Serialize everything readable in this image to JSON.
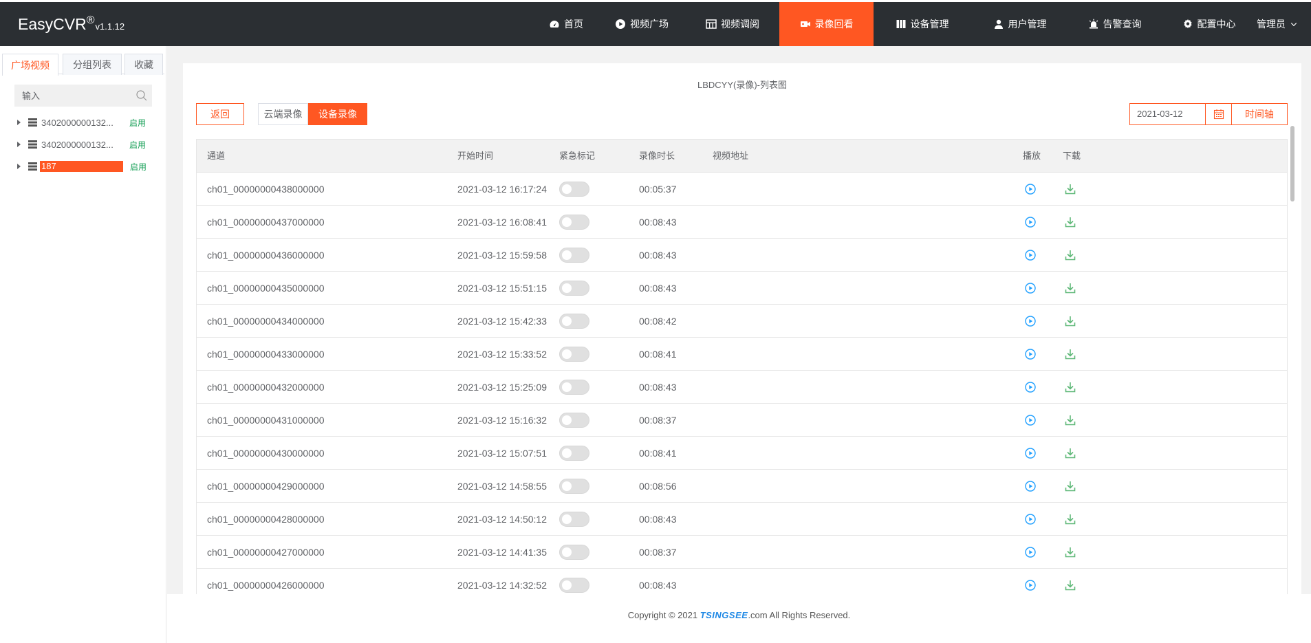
{
  "app": {
    "brand": "EasyCVR",
    "brand_mark": "®",
    "version": "v1.1.12"
  },
  "nav": [
    {
      "label": "首页",
      "icon": "dashboard-icon",
      "active": false
    },
    {
      "label": "视频广场",
      "icon": "play-circle-icon",
      "active": false
    },
    {
      "label": "视频调阅",
      "icon": "grid-icon",
      "active": false
    },
    {
      "label": "录像回看",
      "icon": "video-camera-icon",
      "active": true
    },
    {
      "label": "设备管理",
      "icon": "server-icon",
      "active": false
    },
    {
      "label": "用户管理",
      "icon": "user-icon",
      "active": false
    },
    {
      "label": "告警查询",
      "icon": "alarm-icon",
      "active": false
    },
    {
      "label": "配置中心",
      "icon": "gear-icon",
      "active": false
    }
  ],
  "user_menu": {
    "label": "管理员"
  },
  "sidebar": {
    "tabs": [
      {
        "label": "广场视频",
        "active": true
      },
      {
        "label": "分组列表",
        "active": false
      },
      {
        "label": "收藏",
        "active": false
      }
    ],
    "search_placeholder": "输入",
    "devices": [
      {
        "label": "3402000000132...",
        "status": "启用",
        "selected": false
      },
      {
        "label": "3402000000132...",
        "status": "启用",
        "selected": false
      },
      {
        "label": "187",
        "status": "启用",
        "selected": true
      }
    ]
  },
  "main": {
    "title": "LBDCYY(录像)-列表图",
    "back_label": "返回",
    "segments": [
      {
        "label": "云端录像",
        "active": false
      },
      {
        "label": "设备录像",
        "active": true
      }
    ],
    "date_value": "2021-03-12",
    "timeline_label": "时间轴",
    "table": {
      "headers": {
        "channel": "通道",
        "start": "开始时间",
        "urgent": "紧急标记",
        "duration": "录像时长",
        "url": "视频地址",
        "play": "播放",
        "download": "下载"
      },
      "rows": [
        {
          "channel": "ch01_00000000438000000",
          "start": "2021-03-12 16:17:24",
          "duration": "00:05:37",
          "urgent": false
        },
        {
          "channel": "ch01_00000000437000000",
          "start": "2021-03-12 16:08:41",
          "duration": "00:08:43",
          "urgent": false
        },
        {
          "channel": "ch01_00000000436000000",
          "start": "2021-03-12 15:59:58",
          "duration": "00:08:43",
          "urgent": false
        },
        {
          "channel": "ch01_00000000435000000",
          "start": "2021-03-12 15:51:15",
          "duration": "00:08:43",
          "urgent": false
        },
        {
          "channel": "ch01_00000000434000000",
          "start": "2021-03-12 15:42:33",
          "duration": "00:08:42",
          "urgent": false
        },
        {
          "channel": "ch01_00000000433000000",
          "start": "2021-03-12 15:33:52",
          "duration": "00:08:41",
          "urgent": false
        },
        {
          "channel": "ch01_00000000432000000",
          "start": "2021-03-12 15:25:09",
          "duration": "00:08:43",
          "urgent": false
        },
        {
          "channel": "ch01_00000000431000000",
          "start": "2021-03-12 15:16:32",
          "duration": "00:08:37",
          "urgent": false
        },
        {
          "channel": "ch01_00000000430000000",
          "start": "2021-03-12 15:07:51",
          "duration": "00:08:41",
          "urgent": false
        },
        {
          "channel": "ch01_00000000429000000",
          "start": "2021-03-12 14:58:55",
          "duration": "00:08:56",
          "urgent": false
        },
        {
          "channel": "ch01_00000000428000000",
          "start": "2021-03-12 14:50:12",
          "duration": "00:08:43",
          "urgent": false
        },
        {
          "channel": "ch01_00000000427000000",
          "start": "2021-03-12 14:41:35",
          "duration": "00:08:37",
          "urgent": false
        },
        {
          "channel": "ch01_00000000426000000",
          "start": "2021-03-12 14:32:52",
          "duration": "00:08:43",
          "urgent": false
        }
      ]
    }
  },
  "footer": {
    "prefix": "Copyright © 2021 ",
    "logo": "TSINGSEE",
    "suffix": ".com All Rights Reserved."
  },
  "colors": {
    "accent": "#ff5722",
    "topbar": "#2b2f33",
    "play": "#1e9fff",
    "download": "#5fb878",
    "enabled": "#18a058"
  }
}
